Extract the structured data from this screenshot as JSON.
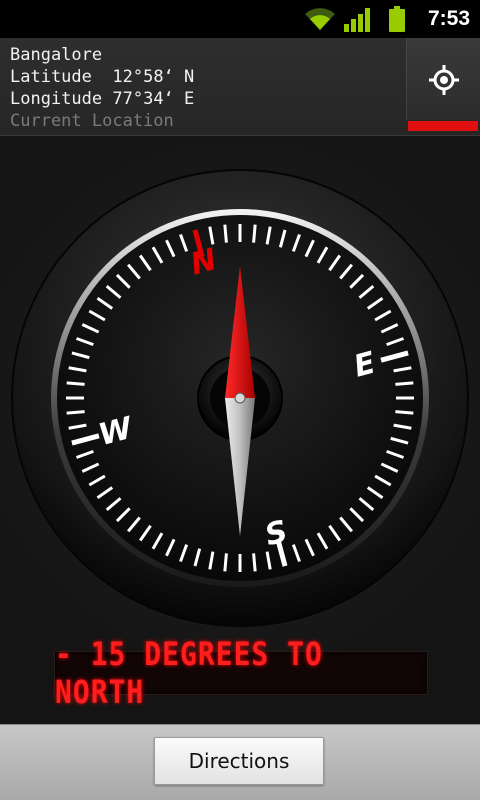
{
  "status_bar": {
    "time": "7:53",
    "icons": [
      "wifi-icon",
      "signal-icon",
      "battery-icon"
    ],
    "accent": "#99cc00"
  },
  "location": {
    "city": "Bangalore",
    "latitude_label": "Latitude",
    "latitude_value": "12°58‘ N",
    "longitude_label": "Longitude",
    "longitude_value": "77°34‘ E",
    "status": "Current Location",
    "locate_icon": "crosshair-icon",
    "indicator_color": "#e01010"
  },
  "compass": {
    "cardinals": {
      "north": "N",
      "east": "E",
      "south": "S",
      "west": "W"
    },
    "needle_north_color": "#e00000",
    "needle_south_color": "#b0b0b0",
    "rotation_degrees": -15
  },
  "readout": {
    "text": "- 15 DEGREES TO NORTH",
    "color": "#ff1e1e"
  },
  "bottom_bar": {
    "directions_label": "Directions"
  }
}
